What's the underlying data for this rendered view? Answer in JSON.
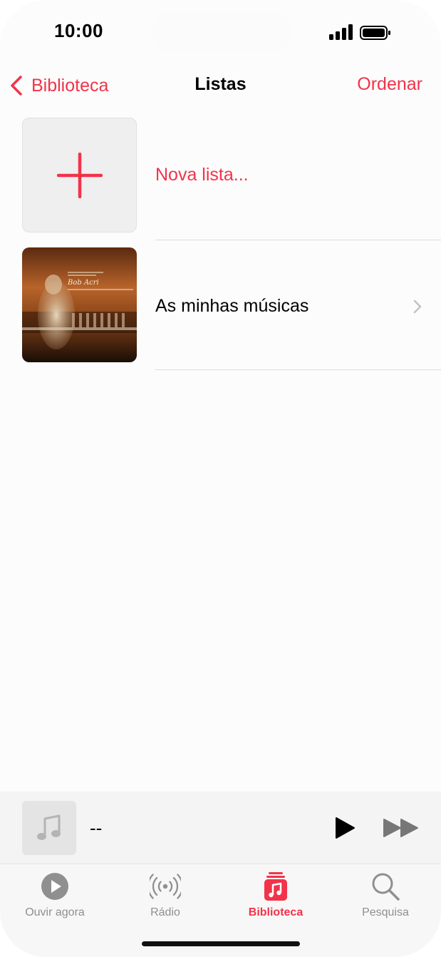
{
  "status_bar": {
    "time": "10:00"
  },
  "nav": {
    "back_label": "Biblioteca",
    "title": "Listas",
    "action_label": "Ordenar"
  },
  "list": {
    "new_playlist_label": "Nova lista...",
    "items": [
      {
        "label": "As minhas músicas",
        "art_text": "Bob Acri"
      }
    ]
  },
  "mini_player": {
    "title": "--"
  },
  "tab_bar": {
    "tabs": [
      {
        "label": "Ouvir agora",
        "icon": "play-circle-icon"
      },
      {
        "label": "Rádio",
        "icon": "radio-icon"
      },
      {
        "label": "Biblioteca",
        "icon": "library-icon",
        "active": true
      },
      {
        "label": "Pesquisa",
        "icon": "search-icon"
      }
    ]
  },
  "colors": {
    "accent": "#f2334a",
    "inactive": "#8f8f8f",
    "background": "#fcfcfc"
  }
}
